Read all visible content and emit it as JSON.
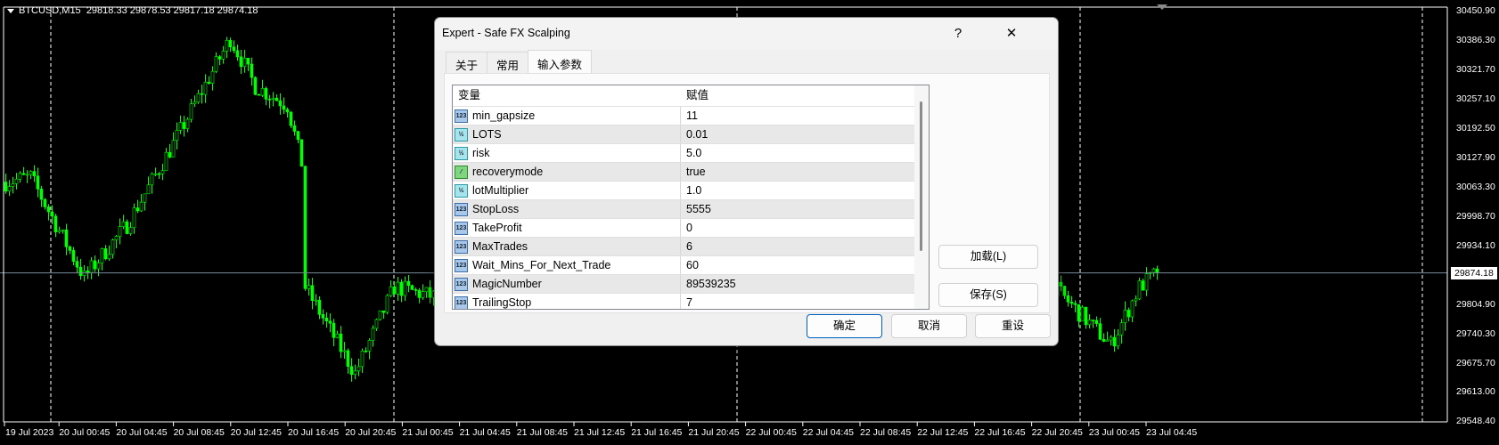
{
  "chart": {
    "symbol": "BTCUSD,M15",
    "ohlc": "29818.33 29878.53 29817.18 29874.18",
    "current_price": "29874.18",
    "current_price_value": 29874.18,
    "price_labels": [
      "30450.90",
      "30386.30",
      "30321.70",
      "30257.10",
      "30192.50",
      "30127.90",
      "30063.30",
      "29998.70",
      "29934.10",
      "29804.90",
      "29740.30",
      "29675.70",
      "29613.00",
      "29548.40"
    ],
    "time_labels": [
      "19 Jul 2023",
      "20 Jul 00:45",
      "20 Jul 04:45",
      "20 Jul 08:45",
      "20 Jul 12:45",
      "20 Jul 16:45",
      "20 Jul 20:45",
      "21 Jul 00:45",
      "21 Jul 04:45",
      "21 Jul 08:45",
      "21 Jul 12:45",
      "21 Jul 16:45",
      "21 Jul 20:45",
      "22 Jul 00:45",
      "22 Jul 04:45",
      "22 Jul 08:45",
      "22 Jul 12:45",
      "22 Jul 16:45",
      "22 Jul 20:45",
      "23 Jul 00:45",
      "23 Jul 04:45"
    ],
    "price_anchors": [
      [
        0,
        30074
      ],
      [
        7,
        30085
      ],
      [
        22,
        29864
      ],
      [
        34,
        29980
      ],
      [
        47,
        30158
      ],
      [
        63,
        30390
      ],
      [
        70,
        30285
      ],
      [
        79,
        30243
      ],
      [
        83,
        30116
      ],
      [
        84,
        29843
      ],
      [
        98,
        29653
      ],
      [
        109,
        29843
      ],
      [
        120,
        29822
      ],
      [
        208,
        29850
      ],
      [
        294,
        29843
      ],
      [
        310,
        29716
      ],
      [
        318,
        29843
      ],
      [
        323,
        29874.18
      ]
    ],
    "candle_color": "#00ff00"
  },
  "dialog": {
    "title": "Expert - Safe FX Scalping",
    "help": "?",
    "close": "✕",
    "tabs": [
      "关于",
      "常用",
      "输入参数"
    ],
    "columns": [
      "变量",
      "赋值"
    ],
    "params": [
      {
        "type": "123",
        "name": "min_gapsize",
        "value": "11"
      },
      {
        "type": "½",
        "name": "LOTS",
        "value": "0.01"
      },
      {
        "type": "½",
        "name": "risk",
        "value": "5.0"
      },
      {
        "type": "bool",
        "name": "recoverymode",
        "value": "true"
      },
      {
        "type": "½",
        "name": "lotMultiplier",
        "value": "1.0"
      },
      {
        "type": "123",
        "name": "StopLoss",
        "value": "5555"
      },
      {
        "type": "123",
        "name": "TakeProfit",
        "value": "0"
      },
      {
        "type": "123",
        "name": "MaxTrades",
        "value": "6"
      },
      {
        "type": "123",
        "name": "Wait_Mins_For_Next_Trade",
        "value": "60"
      },
      {
        "type": "123",
        "name": "MagicNumber",
        "value": "89539235"
      },
      {
        "type": "123",
        "name": "TrailingStop",
        "value": "7"
      }
    ],
    "load": "加载(L)",
    "save": "保存(S)",
    "ok": "确定",
    "cancel": "取消",
    "reset": "重设"
  }
}
